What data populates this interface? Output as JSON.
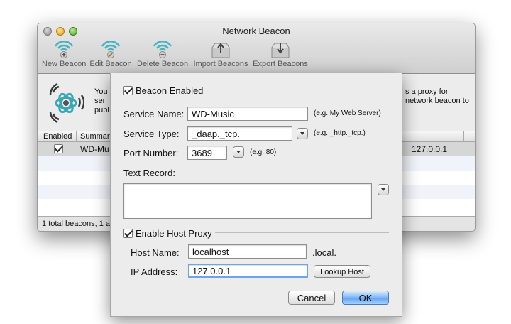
{
  "window": {
    "title": "Network Beacon"
  },
  "toolbar": {
    "new_label": "New Beacon",
    "edit_label": "Edit Beacon",
    "delete_label": "Delete Beacon",
    "import_label": "Import Beacons",
    "export_label": "Export Beacons"
  },
  "info": {
    "line1": "You",
    "line2": "ser",
    "line3": "publ",
    "right1": "s a proxy for",
    "right2": "network beacon to"
  },
  "table": {
    "col_enabled": "Enabled",
    "col_summary": "Summary",
    "row1": {
      "summary": "WD-Mu",
      "address": "127.0.0.1"
    }
  },
  "status": {
    "text": "1 total beacons, 1 ac"
  },
  "dialog": {
    "beacon_enabled_label": "Beacon Enabled",
    "service_name_label": "Service Name:",
    "service_name_value": "WD-Music",
    "service_name_hint": "(e.g. My Web Server)",
    "service_type_label": "Service Type:",
    "service_type_value": "_daap._tcp.",
    "service_type_hint": "(e.g. _http._tcp.)",
    "port_label": "Port Number:",
    "port_value": "3689",
    "port_hint": "(e.g. 80)",
    "text_record_label": "Text Record:",
    "host_proxy_label": "Enable Host Proxy",
    "host_name_label": "Host Name:",
    "host_name_value": "localhost",
    "host_name_suffix": ".local.",
    "ip_label": "IP Address:",
    "ip_value": "127.0.0.1",
    "lookup_label": "Lookup Host",
    "cancel_label": "Cancel",
    "ok_label": "OK"
  },
  "colors": {
    "accent": "#6da6e8",
    "default_button": "#5fa1f2",
    "beacon_teal": "#3aa7b5"
  }
}
